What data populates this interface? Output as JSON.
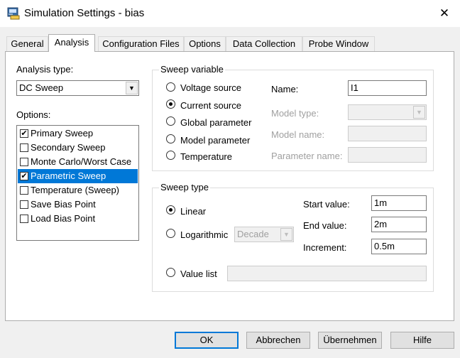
{
  "window": {
    "title": "Simulation Settings - bias",
    "close_glyph": "✕"
  },
  "tabs": [
    {
      "label": "General"
    },
    {
      "label": "Analysis"
    },
    {
      "label": "Configuration Files"
    },
    {
      "label": "Options"
    },
    {
      "label": "Data Collection"
    },
    {
      "label": "Probe Window"
    }
  ],
  "analysis": {
    "analysis_type_label": "Analysis type:",
    "analysis_type_value": "DC Sweep",
    "options_label": "Options:",
    "options": [
      {
        "label": "Primary Sweep",
        "checked": true,
        "selected": false
      },
      {
        "label": "Secondary Sweep",
        "checked": false,
        "selected": false
      },
      {
        "label": "Monte Carlo/Worst Case",
        "checked": false,
        "selected": false
      },
      {
        "label": "Parametric Sweep",
        "checked": true,
        "selected": true
      },
      {
        "label": "Temperature (Sweep)",
        "checked": false,
        "selected": false
      },
      {
        "label": "Save Bias Point",
        "checked": false,
        "selected": false
      },
      {
        "label": "Load Bias Point",
        "checked": false,
        "selected": false
      }
    ]
  },
  "sweep_variable": {
    "caption": "Sweep variable",
    "options": [
      {
        "label": "Voltage source",
        "selected": false
      },
      {
        "label": "Current source",
        "selected": true
      },
      {
        "label": "Global parameter",
        "selected": false
      },
      {
        "label": "Model parameter",
        "selected": false
      },
      {
        "label": "Temperature",
        "selected": false
      }
    ],
    "name_label": "Name:",
    "name_value": "I1",
    "model_type_label": "Model type:",
    "model_type_value": "",
    "model_name_label": "Model name:",
    "model_name_value": "",
    "parameter_name_label": "Parameter name:",
    "parameter_name_value": ""
  },
  "sweep_type": {
    "caption": "Sweep type",
    "linear_label": "Linear",
    "linear_selected": true,
    "log_label": "Logarithmic",
    "log_selected": false,
    "log_scale_value": "Decade",
    "start_label": "Start value:",
    "start_value": "1m",
    "end_label": "End value:",
    "end_value": "2m",
    "increment_label": "Increment:",
    "increment_value": "0.5m",
    "value_list_label": "Value list",
    "value_list_selected": false,
    "value_list_value": ""
  },
  "buttons": {
    "ok": "OK",
    "cancel": "Abbrechen",
    "apply": "Übernehmen",
    "help": "Hilfe"
  },
  "glyphs": {
    "check": "✔",
    "dropdown": "▼"
  },
  "colors": {
    "selection": "#0078d7",
    "default_button_border": "#0078d7"
  }
}
